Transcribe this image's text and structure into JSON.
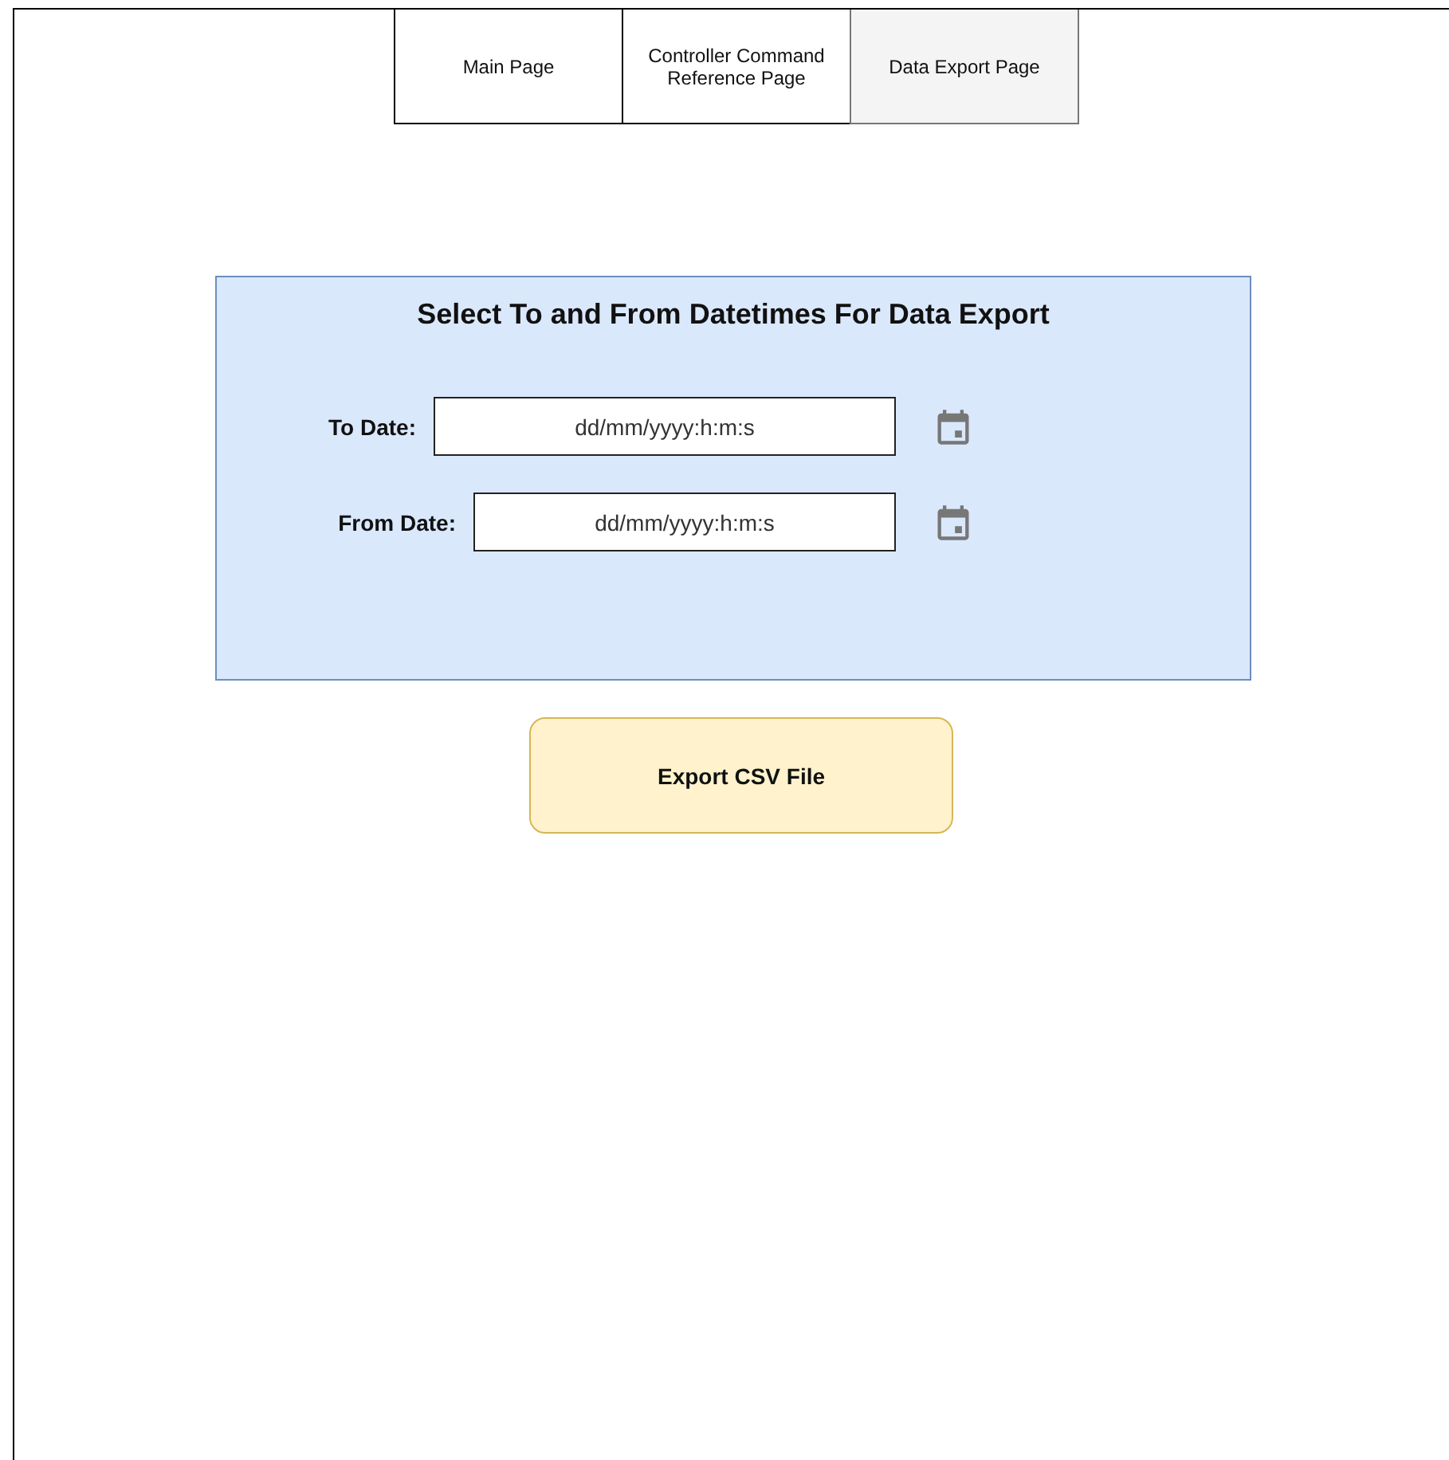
{
  "tabs": [
    {
      "label": "Main Page",
      "selected": false
    },
    {
      "label": "Controller Command Reference Page",
      "selected": false
    },
    {
      "label": "Data Export Page",
      "selected": true
    }
  ],
  "panel": {
    "title": "Select To and From Datetimes For Data Export",
    "fields": [
      {
        "label": "To Date:",
        "placeholder": "dd/mm/yyyy:h:m:s"
      },
      {
        "label": "From Date:",
        "placeholder": "dd/mm/yyyy:h:m:s"
      }
    ]
  },
  "export_button": "Export CSV File"
}
